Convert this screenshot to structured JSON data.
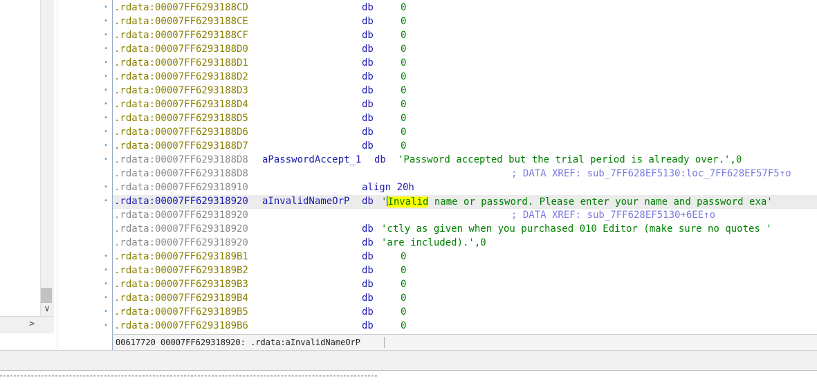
{
  "rows": [
    {
      "addr": ".rdata:00007FF6293188CD",
      "mnem": "db",
      "operand": "0",
      "style": "gold",
      "dot": true
    },
    {
      "addr": ".rdata:00007FF6293188CE",
      "mnem": "db",
      "operand": "0",
      "style": "gold",
      "dot": true
    },
    {
      "addr": ".rdata:00007FF6293188CF",
      "mnem": "db",
      "operand": "0",
      "style": "gold",
      "dot": true
    },
    {
      "addr": ".rdata:00007FF6293188D0",
      "mnem": "db",
      "operand": "0",
      "style": "gold",
      "dot": true
    },
    {
      "addr": ".rdata:00007FF6293188D1",
      "mnem": "db",
      "operand": "0",
      "style": "gold",
      "dot": true
    },
    {
      "addr": ".rdata:00007FF6293188D2",
      "mnem": "db",
      "operand": "0",
      "style": "gold",
      "dot": true
    },
    {
      "addr": ".rdata:00007FF6293188D3",
      "mnem": "db",
      "operand": "0",
      "style": "gold",
      "dot": true
    },
    {
      "addr": ".rdata:00007FF6293188D4",
      "mnem": "db",
      "operand": "0",
      "style": "gold",
      "dot": true
    },
    {
      "addr": ".rdata:00007FF6293188D5",
      "mnem": "db",
      "operand": "0",
      "style": "gold",
      "dot": true
    },
    {
      "addr": ".rdata:00007FF6293188D6",
      "mnem": "db",
      "operand": "0",
      "style": "gold",
      "dot": true
    },
    {
      "addr": ".rdata:00007FF6293188D7",
      "mnem": "db",
      "operand": "0",
      "style": "gold",
      "dot": true
    }
  ],
  "string_rows": {
    "password_accept": {
      "addr": ".rdata:00007FF6293188D8",
      "label": "aPasswordAccept_1",
      "mnem": "db",
      "value": "'Password accepted but the trial period is already over.',0"
    },
    "password_accept_xref": {
      "addr": ".rdata:00007FF6293188D8",
      "xref": "; DATA XREF: sub_7FF628EF5130:loc_7FF628EF57F5↑o"
    },
    "align_row": {
      "addr": ".rdata:00007FF629318910",
      "mnem": "align 20h"
    },
    "invalid_name": {
      "addr": ".rdata:00007FF629318920",
      "label": "aInvalidNameOrP",
      "mnem": "db",
      "quote": "'",
      "highlight": "Invalid",
      "rest": " name or password. Please enter your name and password exa'"
    },
    "invalid_xref": {
      "addr": ".rdata:00007FF629318920",
      "xref": "; DATA XREF: sub_7FF628EF5130+6EE↑o"
    },
    "cont1": {
      "addr": ".rdata:00007FF629318920",
      "mnem": "db",
      "value": "'ctly as given when you purchased 010 Editor (make sure no quotes '"
    },
    "cont2": {
      "addr": ".rdata:00007FF629318920",
      "mnem": "db",
      "value": "'are included).',0"
    }
  },
  "tail_rows": [
    {
      "addr": ".rdata:00007FF6293189B1",
      "mnem": "db",
      "operand": "0"
    },
    {
      "addr": ".rdata:00007FF6293189B2",
      "mnem": "db",
      "operand": "0"
    },
    {
      "addr": ".rdata:00007FF6293189B3",
      "mnem": "db",
      "operand": "0"
    },
    {
      "addr": ".rdata:00007FF6293189B4",
      "mnem": "db",
      "operand": "0"
    },
    {
      "addr": ".rdata:00007FF6293189B5",
      "mnem": "db",
      "operand": "0"
    },
    {
      "addr": ".rdata:00007FF6293189B6",
      "mnem": "db",
      "operand": "0"
    }
  ],
  "status": {
    "text": "00617720 00007FF629318920: .rdata:aInvalidNameOrP"
  },
  "icons": {
    "scroll_down": "chevron-down-icon",
    "scroll_right": "chevron-right-icon"
  },
  "glyphs": {
    "down": "∨",
    "right": ">",
    "dot": "•"
  },
  "colors": {
    "address": "#8a8000",
    "address_grey": "#8a8a8a",
    "instruction": "#1a1ab0",
    "string": "#008000",
    "xref": "#7a7ae0",
    "highlight": "#ffff00"
  }
}
